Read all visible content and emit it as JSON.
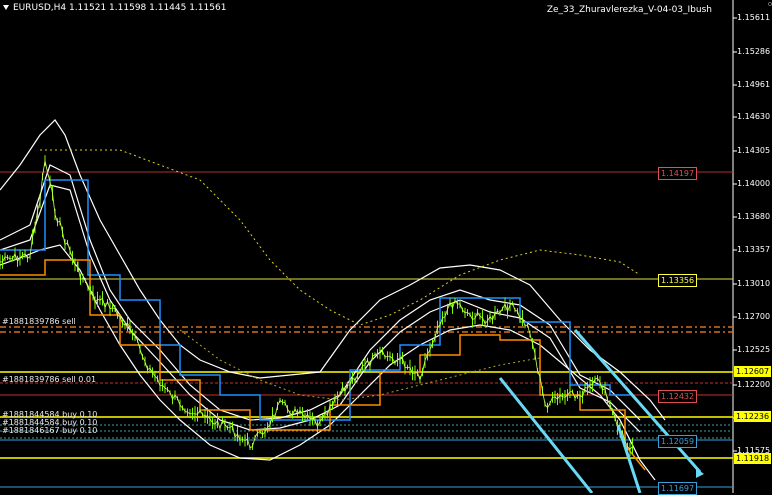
{
  "chart_header": {
    "title": "EURUSD,H4  1.11521 1.11598 1.11445 1.11561",
    "indicator": "Ze_33_Zhuravlerezka_V-04-03_Ibush"
  },
  "colors": {
    "background": "#000000",
    "price_line": "#7cfc00",
    "envelope": "#ffffff",
    "channel_blue": "#1e90ff",
    "channel_orange": "#ff8c00",
    "trend_line": "#6ad9f5",
    "support": "#ffff00",
    "resistance": "#d04040"
  },
  "y_axis": {
    "ticks": [
      "1.15611",
      "1.15286",
      "1.14961",
      "1.14630",
      "1.14305",
      "1.14000",
      "1.13680",
      "1.13357",
      "1.13010",
      "1.12700",
      "1.12525",
      "1.12200",
      "1.11900",
      "1.11575"
    ]
  },
  "price_labels": [
    {
      "text": "1.14197",
      "color": "#e05050"
    },
    {
      "text": "1.13356",
      "color": "#ffff40"
    },
    {
      "text": "1.12432",
      "color": "#e05050"
    },
    {
      "text": "1.12059",
      "color": "#3a9fd9"
    },
    {
      "text": "1.11697",
      "color": "#3a9fd9"
    }
  ],
  "current_boxes": [
    {
      "text": "1.12607"
    },
    {
      "text": "1.12236"
    },
    {
      "text": "1.11918"
    }
  ],
  "orders": [
    {
      "text": "#1881839786 sell"
    },
    {
      "text": "#1881839786 sell 0.01"
    },
    {
      "text": "#1881844584 buy 0.10"
    },
    {
      "text": "#1881844584 buy 0.10"
    },
    {
      "text": "#1881846167 buy 0.10"
    }
  ]
}
